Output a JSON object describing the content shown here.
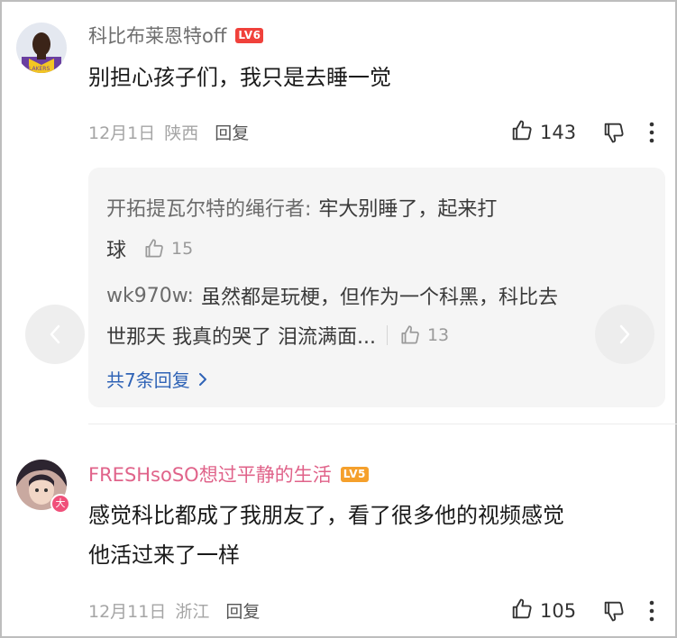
{
  "comments": [
    {
      "username": "科比布莱恩特off",
      "level": "LV6",
      "text": "别担心孩子们，我只是去睡一觉",
      "date": "12月1日",
      "location": "陕西",
      "reply_label": "回复",
      "likes": "143",
      "replies": [
        {
          "author": "开拓提瓦尔特的绳行者:",
          "text_line1": "牢大别睡了，起来打",
          "text_line2": "球",
          "likes": "15"
        },
        {
          "author": "wk970w:",
          "text_line1": "虽然都是玩梗，但作为一个科黑，科比去",
          "text_line2": "世那天 我真的哭了 泪流满面...",
          "likes": "13"
        }
      ],
      "view_more": "共7条回复"
    },
    {
      "username": "FRESHsoSO想过平静的生活",
      "level": "LV5",
      "avatar_badge": "大",
      "text_line1": "感觉科比都成了我朋友了，看了很多他的视频感觉",
      "text_line2": "他活过来了一样",
      "date": "12月11日",
      "location": "浙江",
      "reply_label": "回复",
      "likes": "105"
    }
  ],
  "colors": {
    "lv6_badge": "#f0413b",
    "lv5_badge": "#f5a02c",
    "username_default": "#6e6e6e",
    "username_vip": "#e0638a",
    "link": "#2f63b6"
  },
  "icons": [
    "thumbs-up-icon",
    "thumbs-down-icon",
    "more-vertical-icon",
    "chevron-right-icon",
    "chevron-left-icon"
  ]
}
